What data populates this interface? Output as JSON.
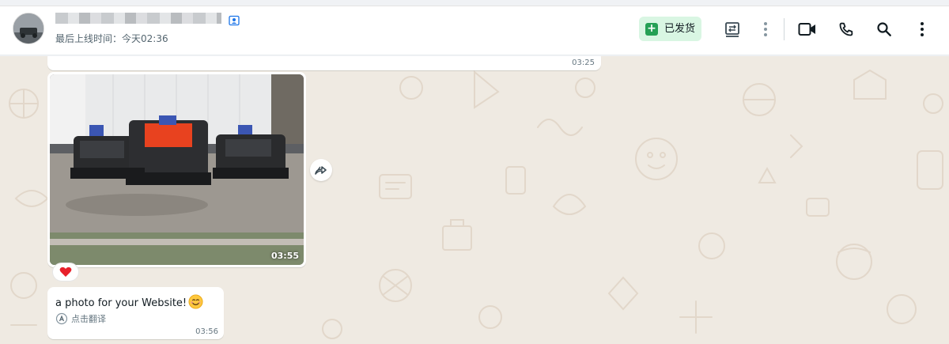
{
  "header": {
    "last_seen": "最后上线时间：今天02:36",
    "shipped_label": "已发货",
    "icons": [
      "contact-card-icon",
      "plus-icon",
      "list-swap-icon",
      "more-vert-icon",
      "video-call-icon",
      "phone-icon",
      "search-icon",
      "menu-icon"
    ]
  },
  "messages": [
    {
      "type": "text",
      "time": "03:25"
    },
    {
      "type": "image",
      "time": "03:55",
      "reaction": "❤️",
      "action_icon": "forward-icon"
    },
    {
      "type": "text",
      "text": "a photo for your Website!",
      "emoji": "😊",
      "translate_label": "点击翻译",
      "time": "03:56"
    }
  ],
  "colors": {
    "header_bg": "#ffffff",
    "chat_bg": "#efeae2",
    "bubble_bg": "#ffffff",
    "shipped_bg": "#d9f6e3",
    "shipped_icon": "#25a055",
    "icon": "#3b4a54"
  }
}
